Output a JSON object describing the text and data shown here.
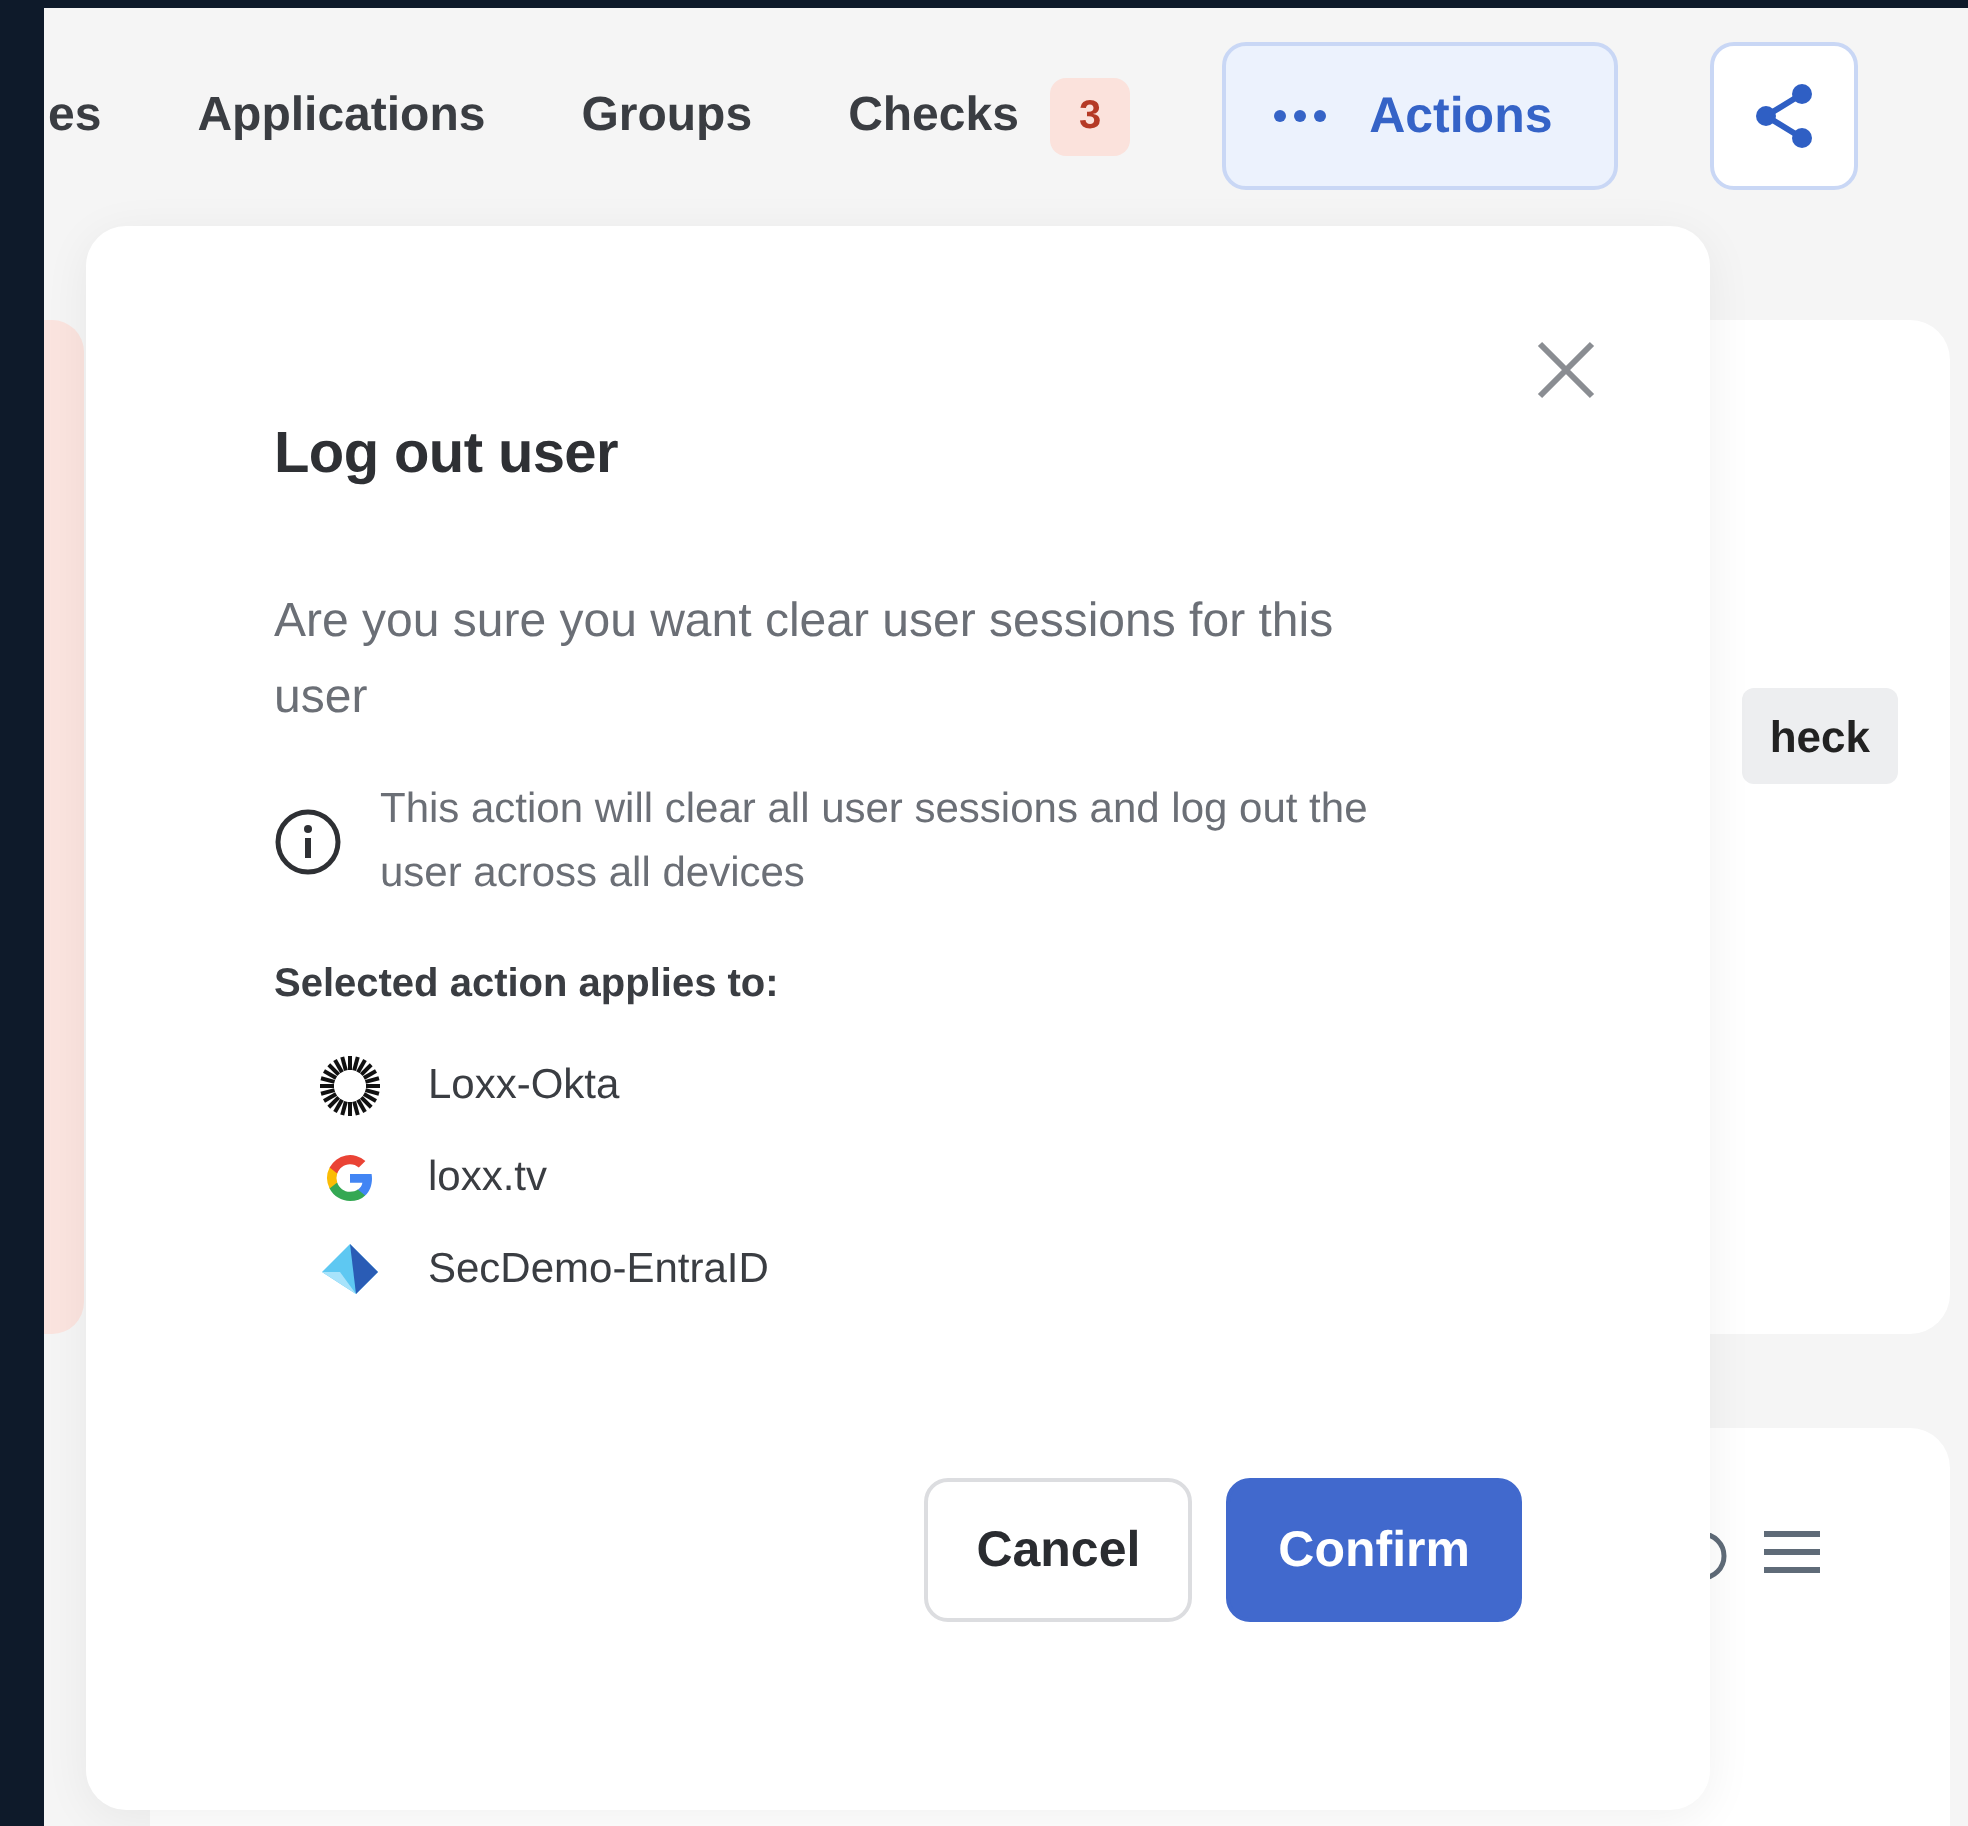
{
  "tabs": [
    {
      "label": "es"
    },
    {
      "label": "Applications"
    },
    {
      "label": "Groups"
    },
    {
      "label": "Checks",
      "badge": "3"
    }
  ],
  "actions_button": {
    "label": "Actions"
  },
  "background": {
    "check_button": "heck"
  },
  "dialog": {
    "title": "Log out user",
    "message": "Are you sure you want clear user sessions for this user",
    "note": "This action will clear all user sessions and log out the user across all devices",
    "applies_label": "Selected action applies to:",
    "targets": [
      {
        "name": "Loxx-Okta",
        "kind": "okta"
      },
      {
        "name": "loxx.tv",
        "kind": "google"
      },
      {
        "name": "SecDemo-EntraID",
        "kind": "entra"
      }
    ],
    "buttons": [
      {
        "label": "Cancel",
        "kind": "secondary"
      },
      {
        "label": "Confirm",
        "kind": "primary"
      }
    ]
  }
}
